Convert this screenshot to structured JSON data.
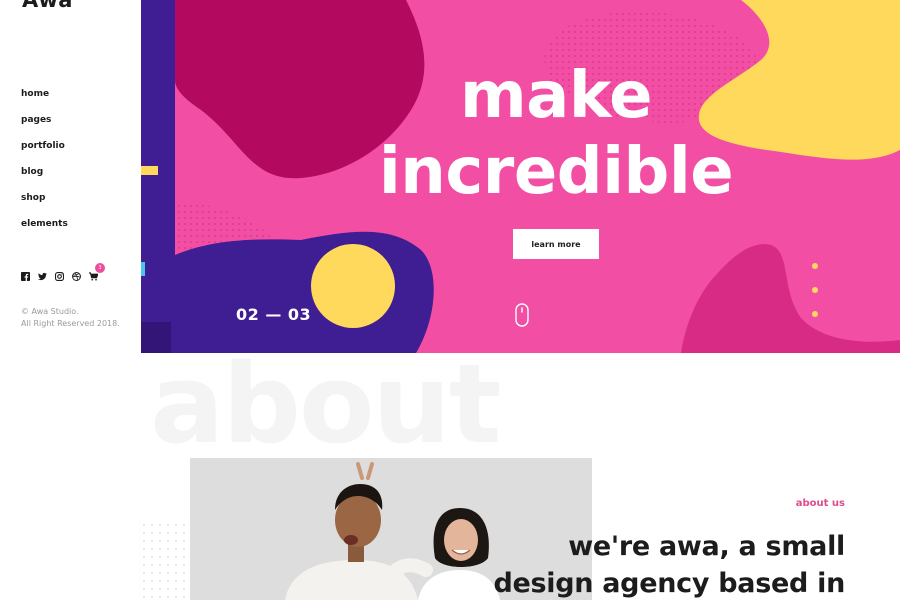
{
  "sidebar": {
    "logo": "Awa",
    "nav": [
      "home",
      "pages",
      "portfolio",
      "blog",
      "shop",
      "elements"
    ],
    "social_icons": [
      "facebook-icon",
      "twitter-icon",
      "instagram-icon",
      "dribbble-icon",
      "cart-icon"
    ],
    "cart_count": "3",
    "copyright_line1": "© Awa Studio.",
    "copyright_line2": "All Right Reserved 2018."
  },
  "hero": {
    "title_line1": "make",
    "title_line2": "incredible",
    "button_label": "learn more",
    "slide_counter": "02 — 03",
    "slide_dot_count": 3,
    "colors": {
      "pink": "#f24ea4",
      "magenta": "#b3095e",
      "purple": "#3f1d92",
      "yellow": "#ffdc66"
    }
  },
  "about": {
    "watermark": "about",
    "label": "about us",
    "heading_line1": "we're awa, a small",
    "heading_line2": "design agency based in"
  }
}
